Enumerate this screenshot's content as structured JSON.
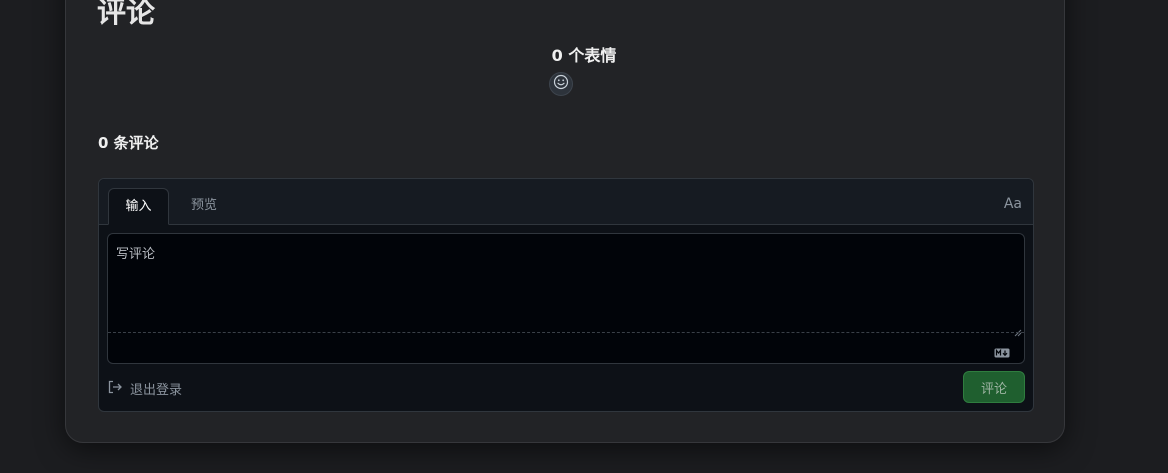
{
  "header": {
    "title": "评论"
  },
  "reactions": {
    "count_label": "0 个表情"
  },
  "comments": {
    "count_label": "0 条评论"
  },
  "editor": {
    "tabs": [
      {
        "label": "输入",
        "active": true
      },
      {
        "label": "预览",
        "active": false
      }
    ],
    "font_toggle_label": "Aa",
    "placeholder": "写评论",
    "signout_label": "退出登录",
    "submit_label": "评论"
  },
  "colors": {
    "page_bg": "#1c1d20",
    "card_bg": "#222326",
    "editor_bg": "#0d1117",
    "submit_green": "#1f5f2f"
  },
  "icons": [
    "smiley-icon",
    "markdown-icon",
    "sign-out-icon"
  ]
}
